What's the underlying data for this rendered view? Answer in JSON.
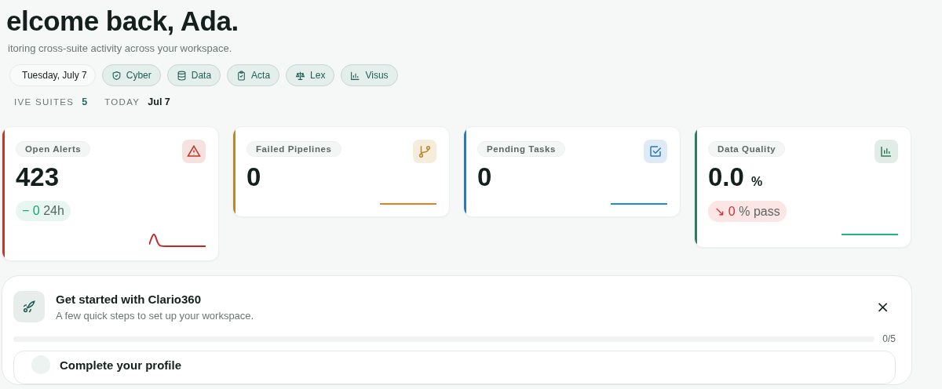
{
  "header": {
    "title": "elcome back, Ada.",
    "subtitle": "itoring cross-suite activity across your workspace."
  },
  "chips": [
    {
      "kind": "date",
      "label": "Tuesday, July 7"
    },
    {
      "kind": "shield",
      "label": "Cyber"
    },
    {
      "kind": "database",
      "label": "Data"
    },
    {
      "kind": "clipboard",
      "label": "Acta"
    },
    {
      "kind": "scale",
      "label": "Lex"
    },
    {
      "kind": "bars",
      "label": "Visus"
    }
  ],
  "stats": [
    {
      "label": "IVE SUITES",
      "value": "5",
      "kind": "accent"
    },
    {
      "label": "TODAY",
      "value": "Jul 7",
      "kind": "plain"
    }
  ],
  "metrics": [
    {
      "kind": "alert",
      "label": "Open Alerts",
      "value": "423",
      "color": "#c0392b",
      "delta": {
        "kind": "flat",
        "symbol": "−",
        "value": "0",
        "suffix": "24h"
      }
    },
    {
      "kind": "branch",
      "label": "Failed Pipelines",
      "value": "0",
      "color": "#b8892f"
    },
    {
      "kind": "check",
      "label": "Pending Tasks",
      "value": "0",
      "color": "#2a7ab8"
    },
    {
      "kind": "chart",
      "label": "Data Quality",
      "value": "0.0",
      "unit": "%",
      "color": "#2e7d5b",
      "delta": {
        "kind": "down",
        "symbol": "↘",
        "value": "0",
        "suffix": "% pass"
      }
    }
  ],
  "onboarding": {
    "title": "Get started with Clario360",
    "subtitle": "A few quick steps to set up your workspace.",
    "close": "×",
    "level": 0,
    "count": "0/5",
    "steps": [
      {
        "label": "Complete your profile",
        "done": false
      }
    ]
  }
}
